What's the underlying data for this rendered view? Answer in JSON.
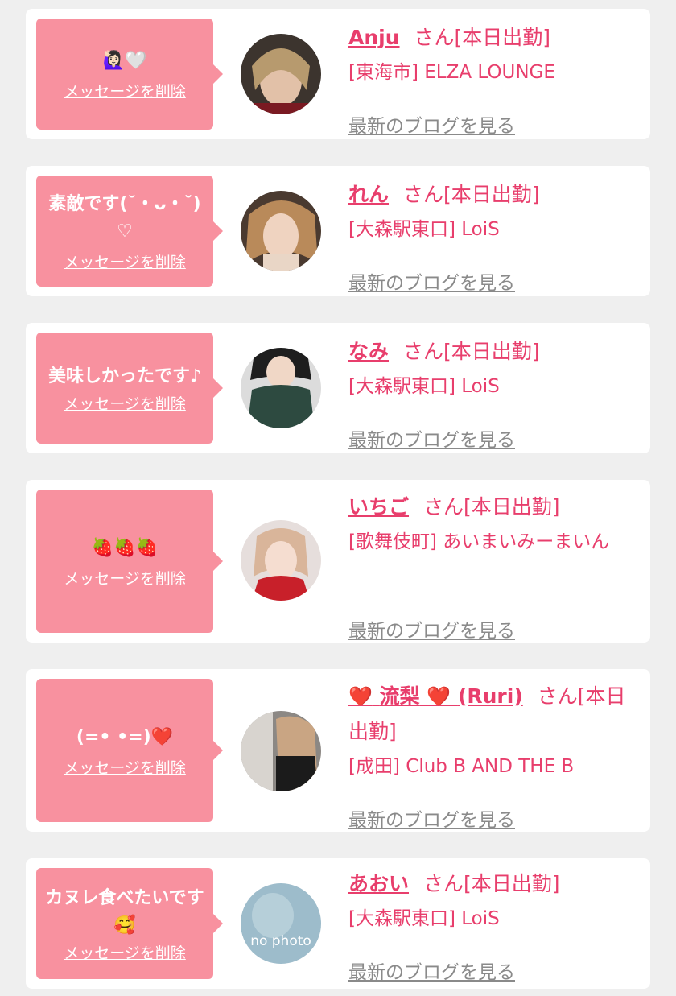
{
  "delete_label": "メッセージを削除",
  "blog_label": "最新のブログを見る",
  "honorific": "さん[本日出勤]",
  "cards": [
    {
      "message": "🙋🏻‍♀️🤍",
      "name": "Anju",
      "shop": "[東海市] ELZA LOUNGE",
      "avatar_color": "#5a4a3a"
    },
    {
      "message": "素敵です(˘・ᴗ・˘)♡",
      "name": "れん",
      "shop": "[大森駅東口] LoiS",
      "avatar_color": "#8a6a50"
    },
    {
      "message": "美味しかったです♪",
      "name": "なみ",
      "shop": "[大森駅東口] LoiS",
      "avatar_color": "#2f3f3a"
    },
    {
      "message": "🍓🍓🍓",
      "name": "いちご",
      "shop": "[歌舞伎町] あいまいみーまいん",
      "avatar_color": "#c7b0a8"
    },
    {
      "message": "(=• •=)❤️",
      "name_prefix": "❤️",
      "name": "流梨",
      "name_mid": "❤️",
      "name_suffix": "(Ruri)",
      "shop": "[成田] Club B AND THE B",
      "avatar_color": "#5a5050"
    },
    {
      "message": "カヌレ食べたいです🥰",
      "name": "あおい",
      "shop": "[大森駅東口] LoiS",
      "avatar_color": "#8fb3c4",
      "avatar_text": "no photo"
    }
  ]
}
